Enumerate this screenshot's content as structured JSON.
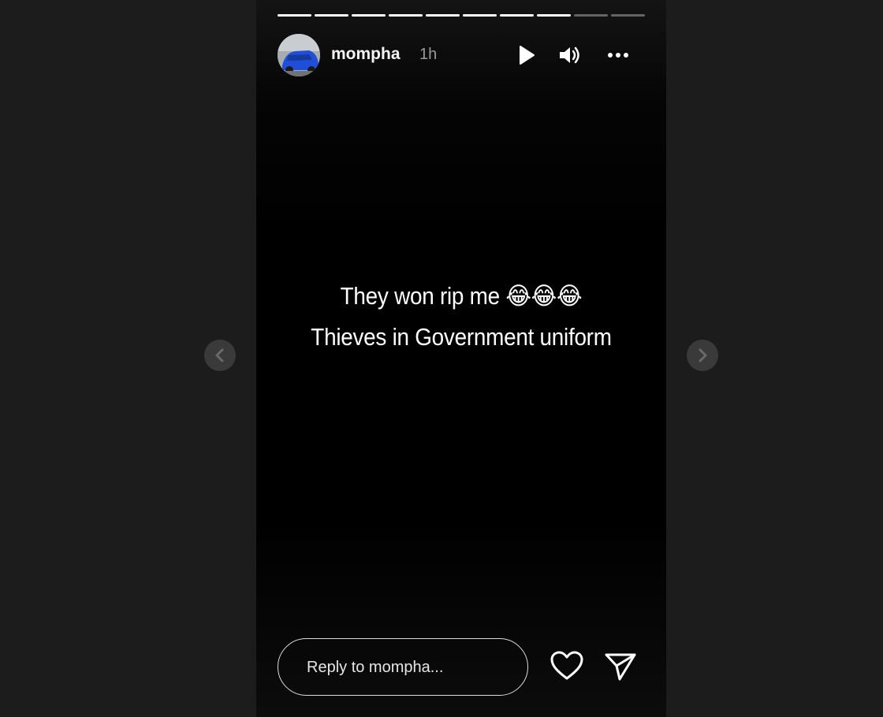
{
  "story": {
    "username": "mompha",
    "time_ago": "1h",
    "segments_total": 10,
    "segments_completed": 8,
    "caption_line1": "They won rip me",
    "caption_emojis": "😂😂😂",
    "caption_line2": "Thieves in Government uniform"
  },
  "reply": {
    "placeholder": "Reply to mompha..."
  },
  "icons": {
    "play": "play-icon",
    "volume": "volume-icon",
    "more": "more-options-icon",
    "like": "heart-icon",
    "share": "send-icon",
    "prev": "chevron-left-icon",
    "next": "chevron-right-icon"
  },
  "colors": {
    "page_background": "#1c1c1d",
    "story_background": "#000000",
    "text": "#ffffff",
    "muted_text": "#9a9a9a"
  }
}
